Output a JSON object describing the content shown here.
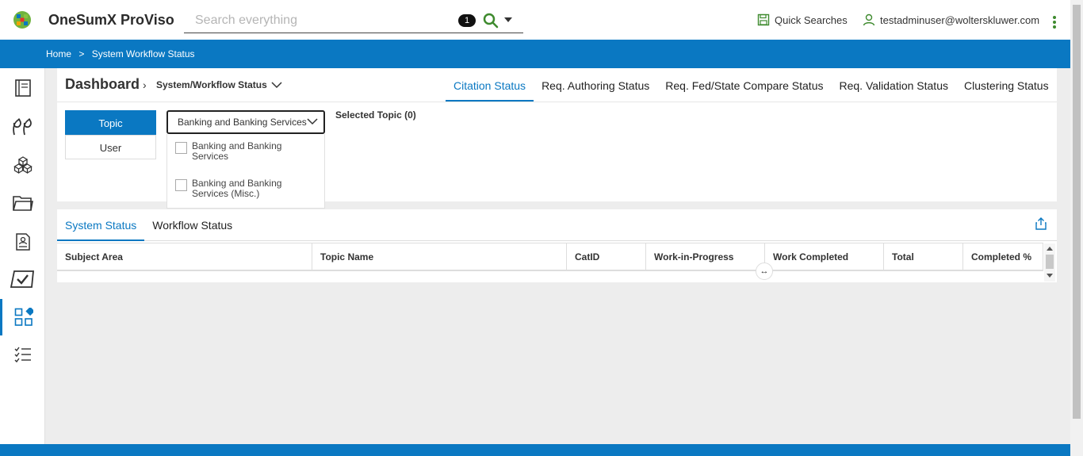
{
  "header": {
    "app_title": "OneSumX ProViso",
    "search_placeholder": "Search everything",
    "search_badge": "1",
    "quick_searches": "Quick Searches",
    "user": "testadminuser@wolterskluwer.com"
  },
  "breadcrumb": {
    "home": "Home",
    "separator": ">",
    "current": "System Workflow Status"
  },
  "dashboard": {
    "title": "Dashboard",
    "subtitle": "System/Workflow Status",
    "tabs": [
      {
        "label": "Citation Status",
        "active": true
      },
      {
        "label": "Req. Authoring Status"
      },
      {
        "label": "Req. Fed/State Compare Status"
      },
      {
        "label": "Req. Validation Status"
      },
      {
        "label": "Clustering Status"
      }
    ]
  },
  "filter": {
    "segments": [
      "Topic",
      "User"
    ],
    "dropdown_value": "Banking and Banking Services",
    "options": [
      "Banking and Banking Services",
      "Banking and Banking Services (Misc.)"
    ],
    "selected_topic": "Selected Topic (0)"
  },
  "status": {
    "tabs": [
      "System Status",
      "Workflow Status"
    ],
    "columns": [
      "Subject Area",
      "Topic Name",
      "CatID",
      "Work-in-Progress",
      "Work Completed",
      "Total",
      "Completed %"
    ]
  },
  "colors": {
    "accent": "#0a78c2",
    "green": "#3e8a2e"
  },
  "icons": {
    "sidebar": [
      "book-icon",
      "quote-icon",
      "cubes-icon",
      "folder-icon",
      "document-user-icon",
      "check-board-icon",
      "apps-icon",
      "checklist-icon"
    ]
  }
}
